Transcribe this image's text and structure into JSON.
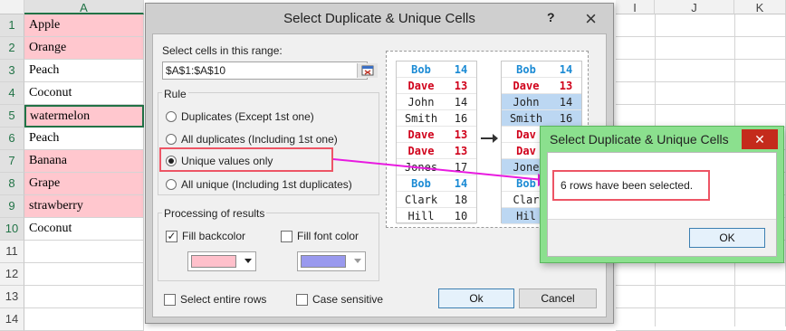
{
  "spreadsheet": {
    "columns": [
      "A",
      "I",
      "J",
      "K"
    ],
    "rows": [
      {
        "num": "1",
        "value": "Apple",
        "pink": true
      },
      {
        "num": "2",
        "value": "Orange",
        "pink": true
      },
      {
        "num": "3",
        "value": "Peach",
        "pink": false
      },
      {
        "num": "4",
        "value": "Coconut",
        "pink": false
      },
      {
        "num": "5",
        "value": "watermelon",
        "pink": true
      },
      {
        "num": "6",
        "value": "Peach",
        "pink": false
      },
      {
        "num": "7",
        "value": "Banana",
        "pink": true
      },
      {
        "num": "8",
        "value": "Grape",
        "pink": true
      },
      {
        "num": "9",
        "value": "strawberry",
        "pink": true
      },
      {
        "num": "10",
        "value": "Coconut",
        "pink": false
      },
      {
        "num": "11",
        "value": "",
        "pink": false
      },
      {
        "num": "12",
        "value": "",
        "pink": false
      },
      {
        "num": "13",
        "value": "",
        "pink": false
      },
      {
        "num": "14",
        "value": "",
        "pink": false
      }
    ]
  },
  "dialog": {
    "title": "Select Duplicate & Unique Cells",
    "help_label": "?",
    "close_label": "×",
    "range_label": "Select cells in this range:",
    "range_value": "$A$1:$A$10",
    "rule_label": "Rule",
    "rules": [
      {
        "label": "Duplicates (Except 1st one)",
        "selected": false
      },
      {
        "label": "All duplicates (Including 1st one)",
        "selected": false
      },
      {
        "label": "Unique values only",
        "selected": true
      },
      {
        "label": "All unique (Including 1st duplicates)",
        "selected": false
      }
    ],
    "processing_label": "Processing of results",
    "fill_backcolor_label": "Fill backcolor",
    "fill_backcolor_checked": true,
    "fill_backcolor_color": "#ffc0cb",
    "fill_fontcolor_label": "Fill font color",
    "fill_fontcolor_checked": false,
    "fill_fontcolor_color": "#9999ee",
    "select_rows_label": "Select entire rows",
    "case_sensitive_label": "Case sensitive",
    "ok_label": "Ok",
    "cancel_label": "Cancel",
    "preview_left": [
      {
        "name": "Bob",
        "num": "14",
        "style": "blue"
      },
      {
        "name": "Dave",
        "num": "13",
        "style": "red"
      },
      {
        "name": "John",
        "num": "14",
        "style": "plain"
      },
      {
        "name": "Smith",
        "num": "16",
        "style": "plain"
      },
      {
        "name": "Dave",
        "num": "13",
        "style": "red"
      },
      {
        "name": "Dave",
        "num": "13",
        "style": "red"
      },
      {
        "name": "Jones",
        "num": "17",
        "style": "plain"
      },
      {
        "name": "Bob",
        "num": "14",
        "style": "blue"
      },
      {
        "name": "Clark",
        "num": "18",
        "style": "plain"
      },
      {
        "name": "Hill",
        "num": "10",
        "style": "plain"
      }
    ],
    "preview_right": [
      {
        "name": "Bob",
        "num": "14",
        "style": "blue"
      },
      {
        "name": "Dave",
        "num": "13",
        "style": "red"
      },
      {
        "name": "John",
        "num": "14",
        "style": "hl"
      },
      {
        "name": "Smith",
        "num": "16",
        "style": "hl"
      },
      {
        "name": "Dav",
        "num": "",
        "style": "red"
      },
      {
        "name": "Dav",
        "num": "",
        "style": "red"
      },
      {
        "name": "Jone",
        "num": "",
        "style": "hl"
      },
      {
        "name": "Bob",
        "num": "",
        "style": "blue"
      },
      {
        "name": "Clar",
        "num": "",
        "style": "plain"
      },
      {
        "name": "Hil",
        "num": "",
        "style": "hl"
      }
    ]
  },
  "popup": {
    "title": "Select Duplicate & Unique Cells",
    "close_label": "✕",
    "message": "6 rows have been selected.",
    "ok_label": "OK"
  },
  "colors": {
    "pink_fill": "#ffc7ce",
    "highlight_red": "#ed5565",
    "arrow_magenta": "#e81ae0",
    "popup_green": "#8be08e"
  }
}
